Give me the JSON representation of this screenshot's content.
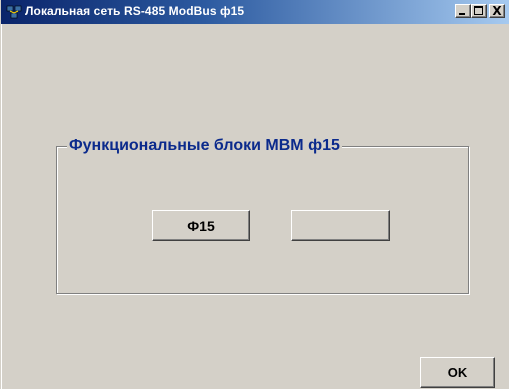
{
  "window": {
    "title": "Локальная сеть RS-485 ModBus ф15",
    "icon": "network-app-icon"
  },
  "titlebar_buttons": {
    "minimize": "minimize-icon",
    "maximize": "maximize-icon",
    "close_glyph": "X"
  },
  "group": {
    "legend": "Функциональные блоки МВМ ф15"
  },
  "buttons": {
    "f15_label": "Ф15",
    "empty_label": "",
    "ok_label": "OK"
  },
  "colors": {
    "titlebar_start": "#0a246a",
    "titlebar_end": "#a6caf0",
    "face": "#d4d0c8",
    "legend_text": "#0b2a8c"
  }
}
